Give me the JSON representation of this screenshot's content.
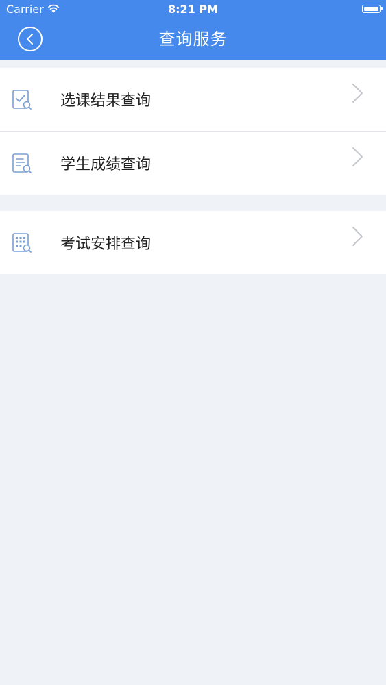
{
  "status_bar": {
    "carrier": "Carrier",
    "time": "8:21 PM"
  },
  "nav": {
    "title": "查询服务"
  },
  "sections": [
    {
      "items": [
        {
          "label": "选课结果查询",
          "icon": "course-check-icon"
        },
        {
          "label": "学生成绩查询",
          "icon": "grade-document-icon"
        }
      ]
    },
    {
      "items": [
        {
          "label": "考试安排查询",
          "icon": "exam-calendar-icon"
        }
      ]
    }
  ],
  "colors": {
    "nav_background": "#4589ec",
    "page_background": "#eff2f6",
    "icon_stroke": "#7a9fd4"
  }
}
